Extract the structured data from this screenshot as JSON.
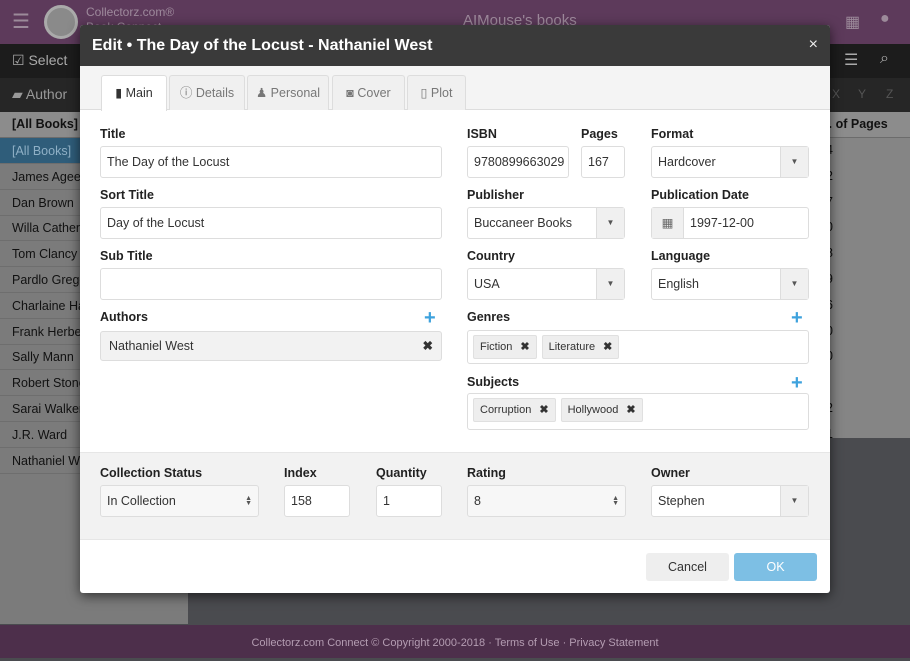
{
  "app": {
    "brand_line1": "Collectorz.com®",
    "brand_line2": "Book Connect",
    "title": "AIMouse's books"
  },
  "toolbar": {
    "select_label": "Select",
    "author_label": "Author",
    "alpha": [
      "X",
      "Y",
      "Z"
    ]
  },
  "sidebar": {
    "header": "[All Books]",
    "items": [
      "[All Books]",
      "James Agee",
      "Dan Brown",
      "Willa Cather",
      "Tom Clancy",
      "Pardlo Gregory",
      "Charlaine Harris",
      "Frank Herbert",
      "Sally Mann",
      "Robert Stone",
      "Sarai Walker",
      "J.R. Ward",
      "Nathaniel West"
    ],
    "selected_index": 0
  },
  "list": {
    "pages_header": "No. of Pages",
    "pages_digits": [
      "4",
      "2",
      "7",
      "0",
      "8",
      "9",
      "6",
      "0",
      "0",
      "",
      "2",
      "1"
    ]
  },
  "footer": {
    "text": "Collectorz.com Connect © Copyright 2000-2018 · Terms of Use · Privacy Statement"
  },
  "modal": {
    "title": "Edit • The Day of the Locust - Nathaniel West",
    "close": "×",
    "tabs": [
      {
        "label": "Main",
        "icon": "book-icon"
      },
      {
        "label": "Details",
        "icon": "info-icon"
      },
      {
        "label": "Personal",
        "icon": "user-icon"
      },
      {
        "label": "Cover",
        "icon": "camera-icon"
      },
      {
        "label": "Plot",
        "icon": "file-icon"
      }
    ],
    "active_tab": "Main",
    "fields": {
      "title": {
        "label": "Title",
        "value": "The Day of the Locust"
      },
      "sort_title": {
        "label": "Sort Title",
        "value": "Day of the Locust"
      },
      "sub_title": {
        "label": "Sub Title",
        "value": ""
      },
      "authors": {
        "label": "Authors",
        "value": "Nathaniel West"
      },
      "isbn": {
        "label": "ISBN",
        "value": "9780899663029"
      },
      "pages": {
        "label": "Pages",
        "value": "167"
      },
      "format": {
        "label": "Format",
        "value": "Hardcover"
      },
      "publisher": {
        "label": "Publisher",
        "value": "Buccaneer Books"
      },
      "publication_date": {
        "label": "Publication Date",
        "value": "1997-12-00"
      },
      "country": {
        "label": "Country",
        "value": "USA"
      },
      "language": {
        "label": "Language",
        "value": "English"
      },
      "genres": {
        "label": "Genres",
        "values": [
          "Fiction",
          "Literature"
        ]
      },
      "subjects": {
        "label": "Subjects",
        "values": [
          "Corruption",
          "Hollywood"
        ]
      },
      "collection_status": {
        "label": "Collection Status",
        "value": "In Collection"
      },
      "index": {
        "label": "Index",
        "value": "158"
      },
      "quantity": {
        "label": "Quantity",
        "value": "1"
      },
      "rating": {
        "label": "Rating",
        "value": "8"
      },
      "owner": {
        "label": "Owner",
        "value": "Stephen"
      }
    },
    "cancel_label": "Cancel",
    "ok_label": "OK",
    "colors": {
      "accent": "#3ea2dd",
      "ok": "#7dbfe4",
      "header": "#3a3a3a"
    }
  }
}
